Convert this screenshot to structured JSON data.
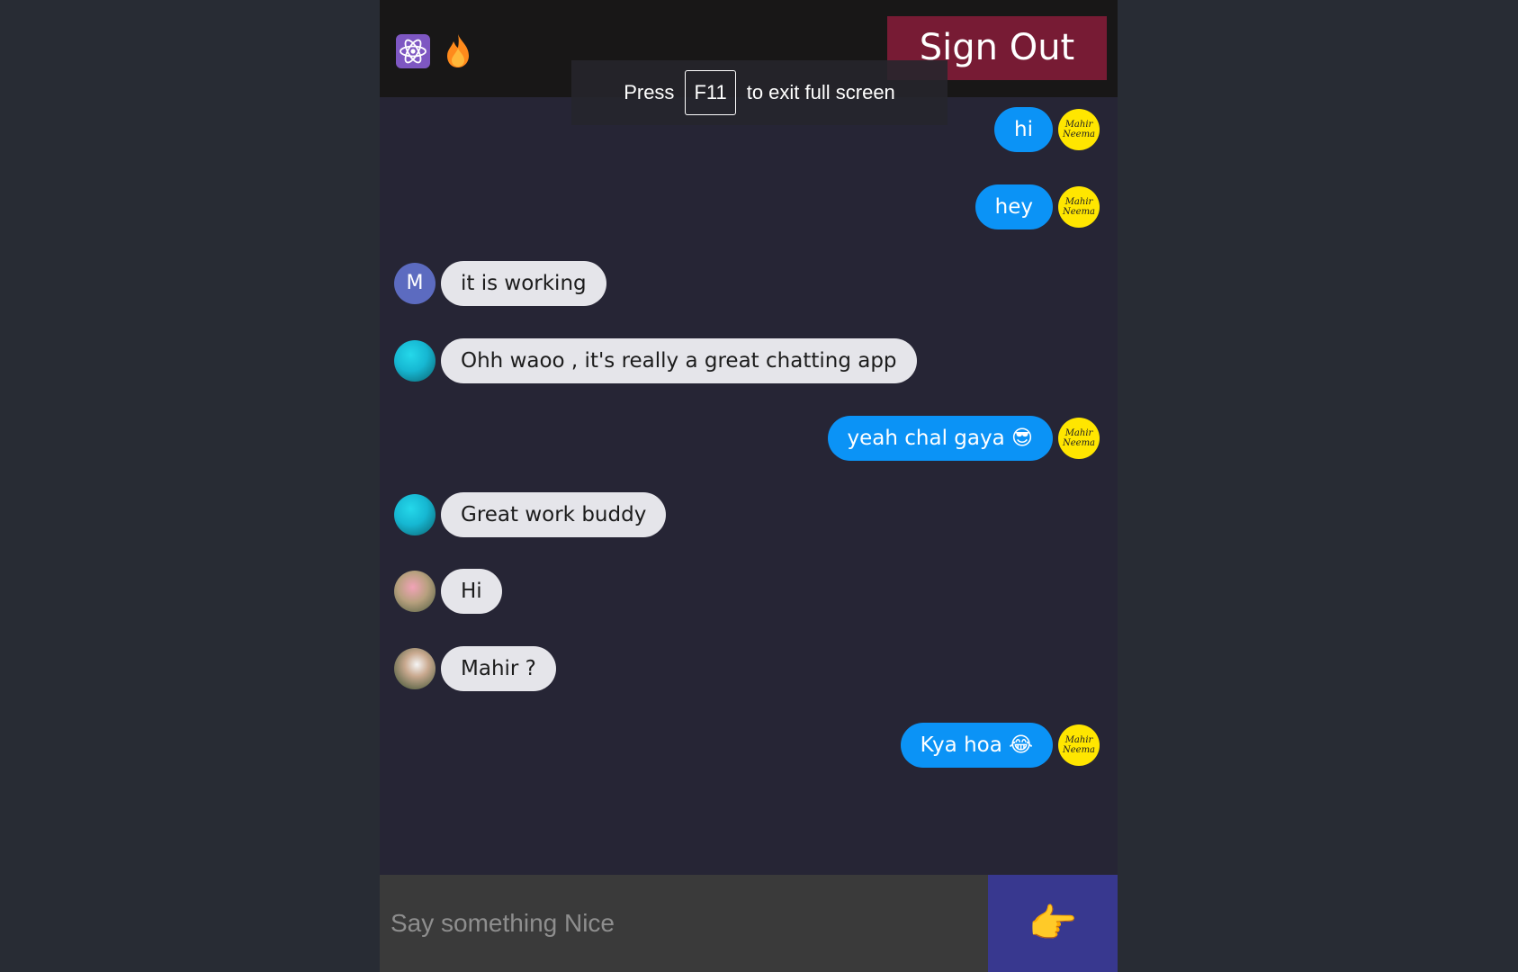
{
  "header": {
    "signout_label": "Sign Out"
  },
  "fullscreen_toast": {
    "press": "Press",
    "key": "F11",
    "rest": "to exit full screen"
  },
  "messages": [
    {
      "from": "me",
      "text": "hi",
      "avatar_text": "Mahir Neema"
    },
    {
      "from": "me",
      "text": "hey",
      "avatar_text": "Mahir Neema"
    },
    {
      "from": "other",
      "text": "it is working",
      "avatar_text": "M"
    },
    {
      "from": "other",
      "text": "Ohh waoo , it's really a great chatting app"
    },
    {
      "from": "me",
      "text": "yeah chal gaya 😎",
      "avatar_text": "Mahir Neema"
    },
    {
      "from": "other",
      "text": "Great work buddy"
    },
    {
      "from": "other",
      "text": "Hi"
    },
    {
      "from": "other",
      "text": "Mahir ?"
    },
    {
      "from": "me",
      "text": "Kya hoa 😂",
      "avatar_text": "Mahir Neema"
    }
  ],
  "composer": {
    "placeholder": "Say something Nice",
    "send_label": "👉"
  },
  "colors": {
    "sent_bubble": "#0b93f6",
    "received_bubble": "#e5e5ea",
    "signout": "#771b34",
    "send_button": "#38388f"
  }
}
